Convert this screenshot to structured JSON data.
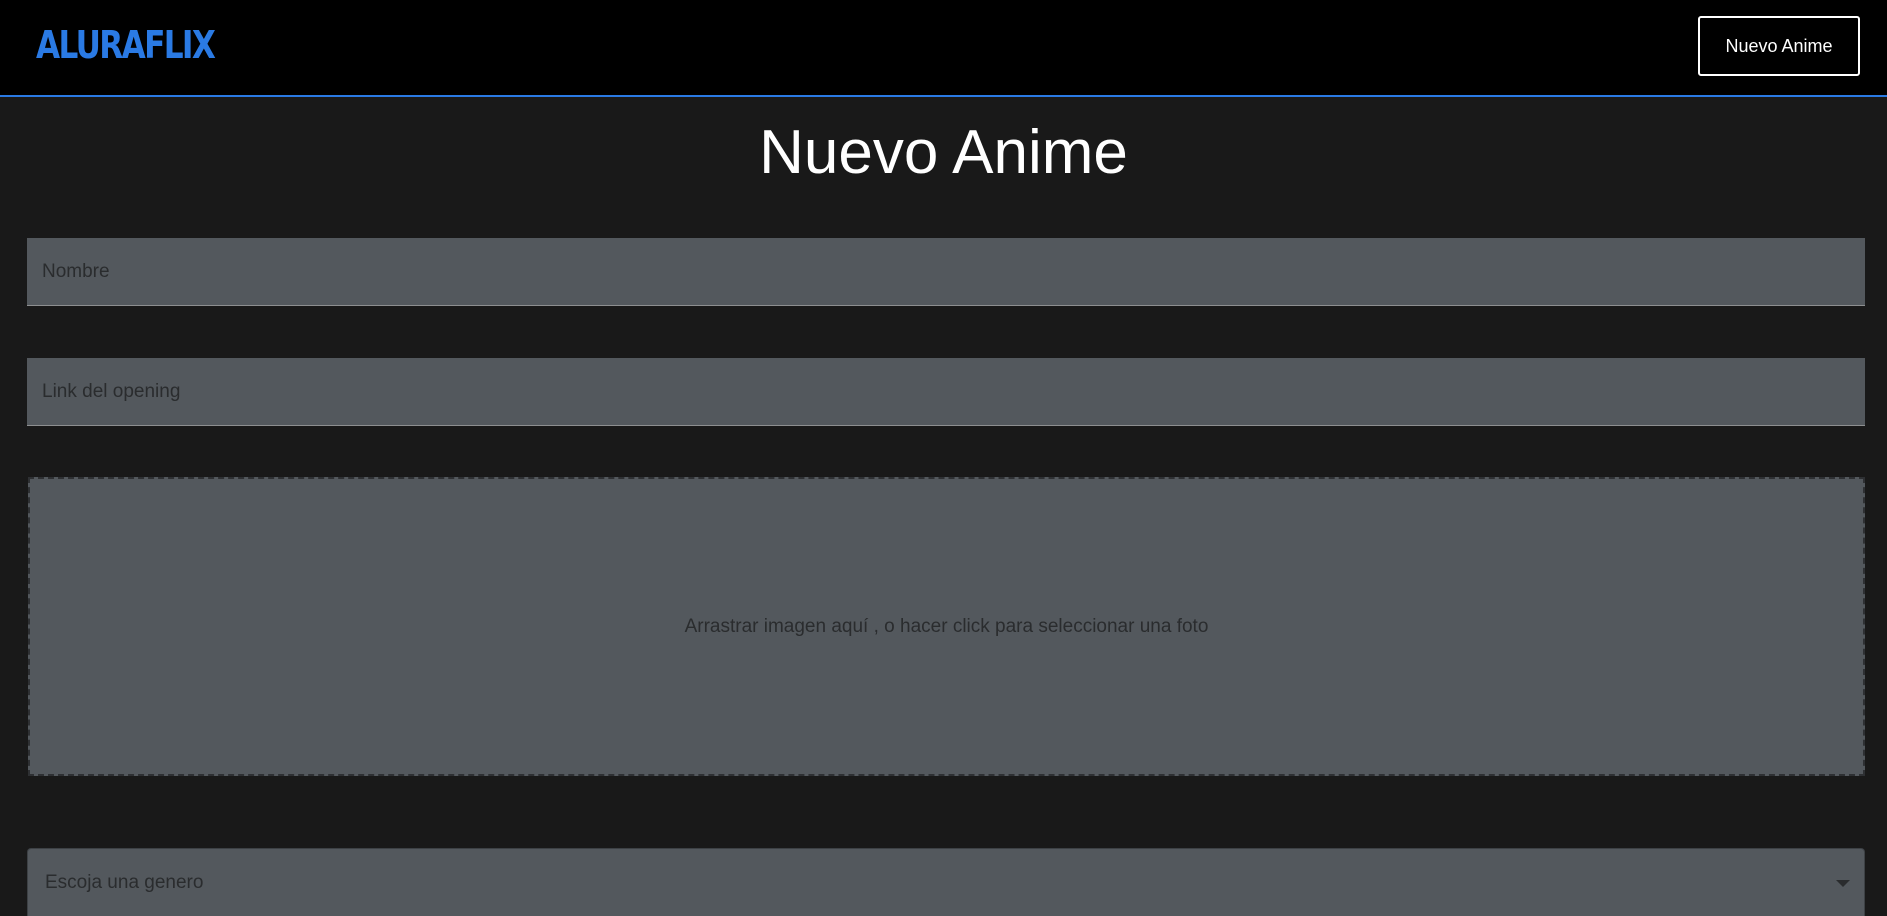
{
  "header": {
    "logo_text": "ALURAFLIX",
    "new_anime_button": "Nuevo Anime"
  },
  "page": {
    "title": "Nuevo Anime"
  },
  "form": {
    "name_placeholder": "Nombre",
    "opening_link_placeholder": "Link del opening",
    "image_dropzone_text": "Arrastrar imagen aquí , o hacer click para seleccionar una foto",
    "genre_select_value": "Escoja una genero"
  },
  "colors": {
    "accent": "#2a7ae4",
    "header_background": "#000000",
    "page_background": "#191919",
    "field_background": "#53585d"
  },
  "icons": {
    "select_arrow": "chevron-down-icon"
  }
}
